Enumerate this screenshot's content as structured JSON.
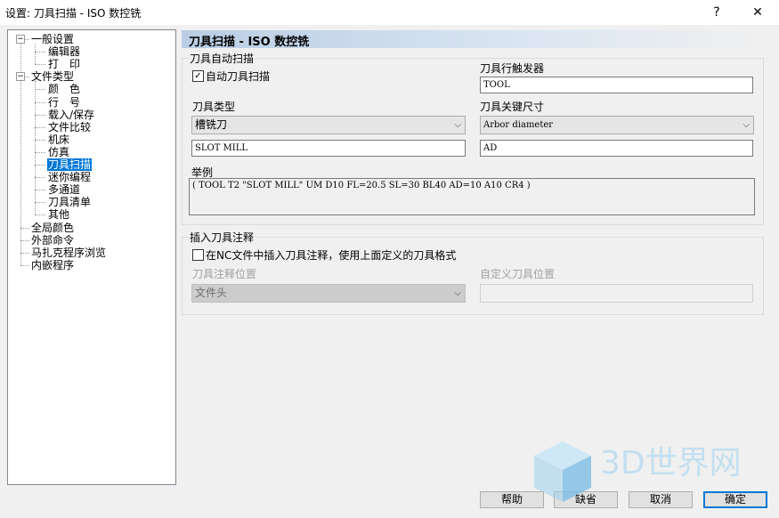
{
  "window": {
    "title": "设置: 刀具扫描 - ISO 数控铣",
    "help_glyph": "?",
    "close_glyph": "✕"
  },
  "tree": {
    "items": [
      {
        "label": "一般设置",
        "level": 0,
        "expander": "−"
      },
      {
        "label": "编辑器",
        "level": 1
      },
      {
        "label": "打　印",
        "level": 1
      },
      {
        "label": "文件类型",
        "level": 0,
        "expander": "−"
      },
      {
        "label": "颜　色",
        "level": 1
      },
      {
        "label": "行　号",
        "level": 1
      },
      {
        "label": "载入/保存",
        "level": 1
      },
      {
        "label": "文件比较",
        "level": 1
      },
      {
        "label": "机床",
        "level": 1
      },
      {
        "label": "仿真",
        "level": 1
      },
      {
        "label": "刀具扫描",
        "level": 1,
        "selected": true
      },
      {
        "label": "迷你编程",
        "level": 1
      },
      {
        "label": "多通道",
        "level": 1
      },
      {
        "label": "刀具清单",
        "level": 1
      },
      {
        "label": "其他",
        "level": 1
      },
      {
        "label": "全局颜色",
        "level": 0
      },
      {
        "label": "外部命令",
        "level": 0
      },
      {
        "label": "马扎克程序浏览",
        "level": 0
      },
      {
        "label": "内嵌程序",
        "level": 0
      }
    ]
  },
  "panel": {
    "header": "刀具扫描 - ISO 数控铣",
    "auto_group": {
      "title": "刀具自动扫描",
      "auto_checkbox": {
        "label": "自动刀具扫描",
        "checked": true,
        "mark": "✓"
      },
      "trigger_label": "刀具行触发器",
      "trigger_value": "TOOL",
      "tool_type_label": "刀具类型",
      "tool_type_value": "槽铣刀",
      "key_size_label": "刀具关键尺寸",
      "key_size_value": "Arbor diameter",
      "tool_name_value": "SLOT MILL",
      "key_code_value": "AD",
      "example_label": "举例",
      "example_value": "( TOOL T2 \"SLOT MILL\" UM D10 FL=20.5 SL=30 BL40 AD=10 A10 CR4 )"
    },
    "insert_group": {
      "title": "插入刀具注释",
      "insert_checkbox": {
        "label": "在NC文件中插入刀具注释，使用上面定义的刀具格式",
        "checked": false
      },
      "position_label": "刀具注释位置",
      "position_value": "文件头",
      "custom_label": "自定义刀具位置",
      "custom_value": ""
    }
  },
  "buttons": {
    "help": "帮助",
    "default": "缺省",
    "cancel": "取消",
    "ok": "确定"
  },
  "dropdown_glyph": "⌵",
  "watermark": "3D世界网"
}
